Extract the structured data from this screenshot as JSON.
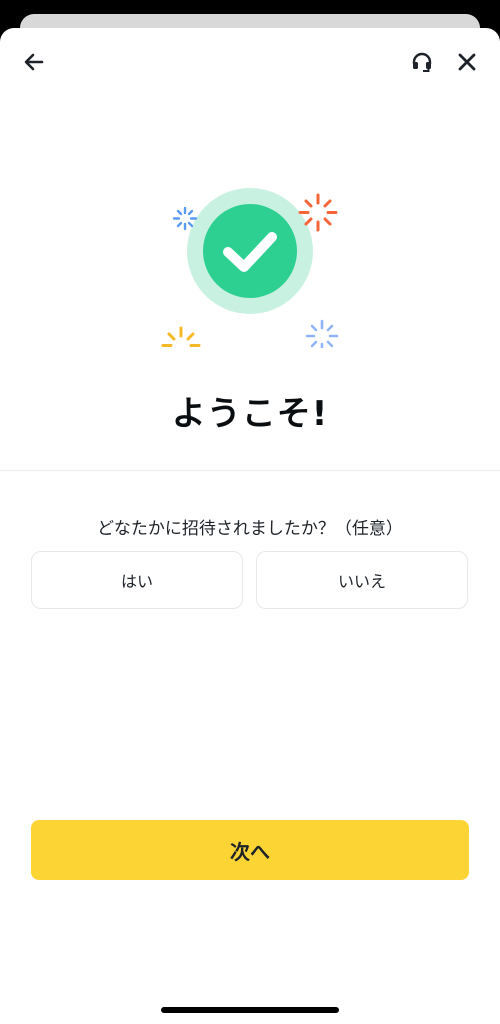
{
  "app": {
    "welcome_title": "ようこそ!",
    "question": "どなたかに招待されましたか？（任意）"
  },
  "topbar": {
    "back_icon": "arrow-left-icon",
    "support_icon": "headset-icon",
    "close_icon": "close-icon"
  },
  "choices": {
    "yes_label": "はい",
    "no_label": "いいえ"
  },
  "footer": {
    "next_label": "次へ"
  },
  "colors": {
    "accent": "#FCD535",
    "success": "#2ED092",
    "success_halo": "#C9F1E1",
    "sparkle_red": "#F6643A",
    "sparkle_blue": "#5B9BF5",
    "sparkle_blue_light": "#8FB4F8",
    "sparkle_yellow": "#F5B826",
    "text": "#1E2329"
  }
}
